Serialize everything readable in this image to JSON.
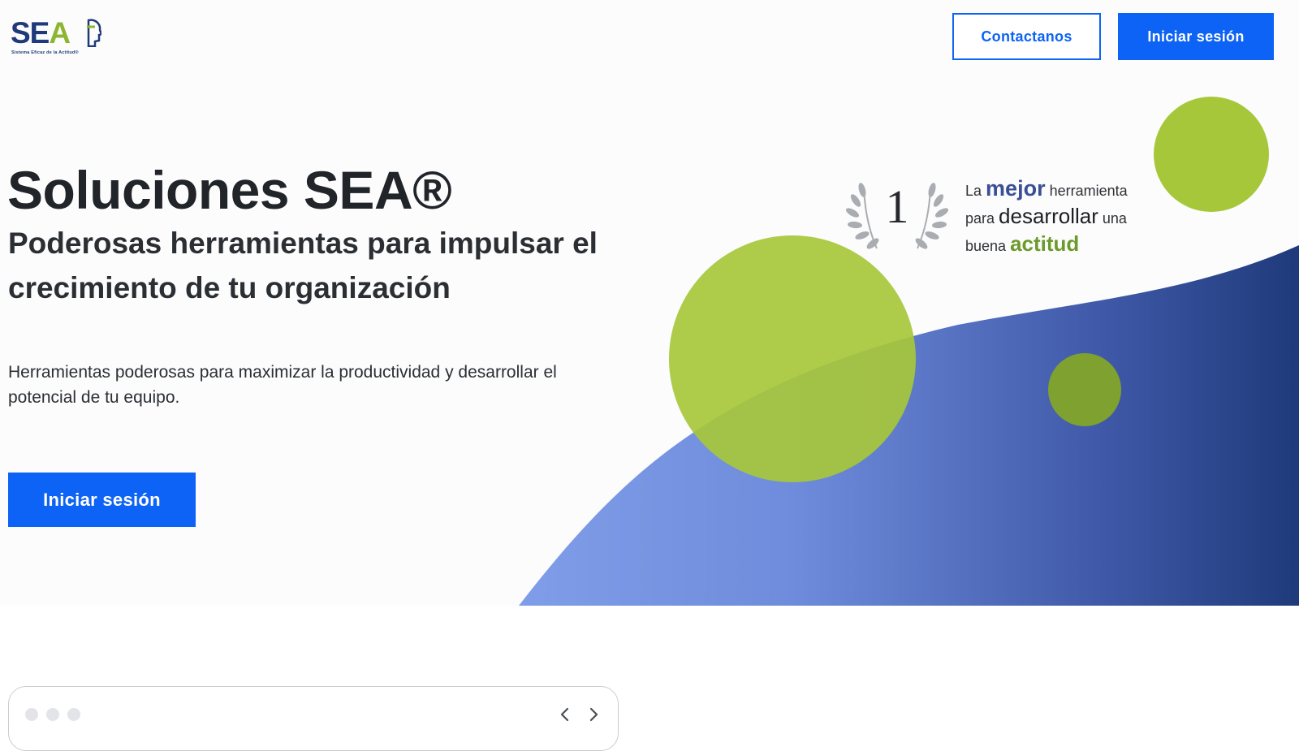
{
  "brand": {
    "logo_text_sea": "SE",
    "logo_text_a": "A",
    "logo_tagline": "Sistema Eficaz de la Actitud®",
    "colors": {
      "primary_blue": "#0d63f5",
      "logo_navy": "#1f3a7a",
      "accent_green": "#a7c73b",
      "dark_green": "#7fa12f"
    }
  },
  "header": {
    "contact_label": "Contactanos",
    "login_label": "Iniciar sesión"
  },
  "hero": {
    "title": "Soluciones SEA®",
    "subtitle": "Poderosas herramientas para impulsar el crecimiento de tu organización",
    "description": "Herramientas poderosas para maximizar la productividad y desarrollar el potencial de tu equipo.",
    "cta_label": "Iniciar sesión"
  },
  "award": {
    "number": "1",
    "w_la": "La",
    "w_mejor": "mejor",
    "w_herramienta": "herramienta",
    "w_para": "para",
    "w_desarrollar": "desarrollar",
    "w_una": "una",
    "w_buena": "buena",
    "w_actitud": "actitud",
    "icon": "laurel-wreath-icon"
  },
  "browser_frame": {
    "icons": [
      "window-dot-icon",
      "chevron-left-icon",
      "chevron-right-icon"
    ]
  }
}
